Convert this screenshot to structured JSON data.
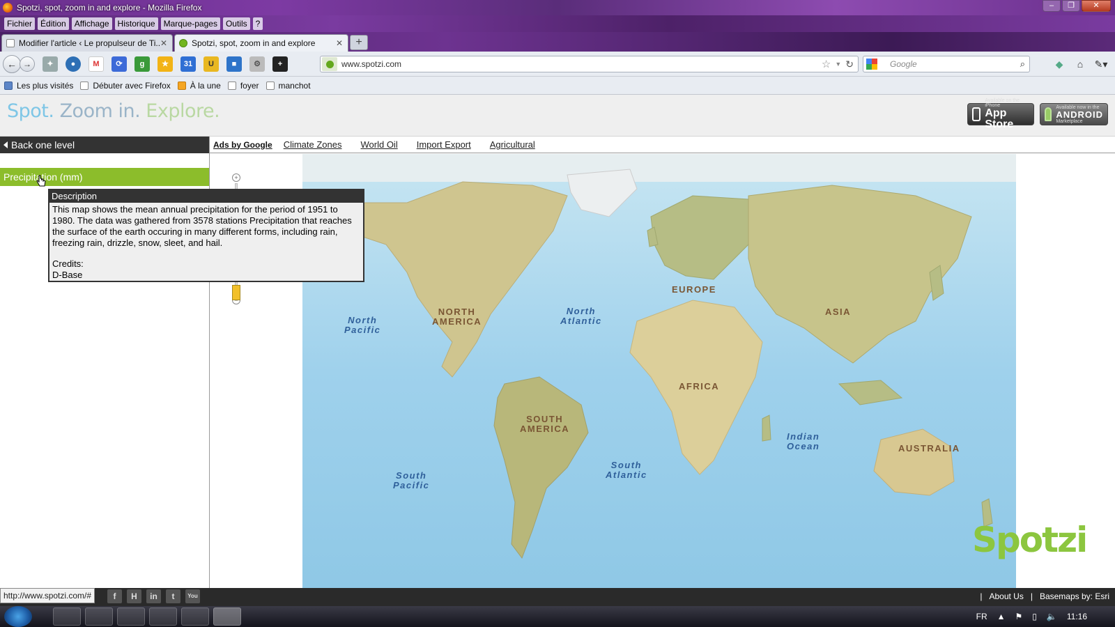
{
  "window": {
    "title": "Spotzi, spot, zoom in and explore - Mozilla Firefox"
  },
  "menu": [
    "Fichier",
    "Édition",
    "Affichage",
    "Historique",
    "Marque-pages",
    "Outils",
    "?"
  ],
  "tabs": [
    {
      "label": "Modifier l'article ‹ Le propulseur de Ti..."
    },
    {
      "label": "Spotzi, spot, zoom in and explore"
    }
  ],
  "address": {
    "url": "www.spotzi.com"
  },
  "search": {
    "placeholder": "Google"
  },
  "bookmarks": [
    "Les plus visités",
    "Débuter avec Firefox",
    "À la une",
    "foyer",
    "manchot"
  ],
  "header": {
    "tagline": {
      "spot": "Spot.",
      "zoom": "Zoom in.",
      "explore": "Explore."
    },
    "appstore": {
      "small": "Available on the iPhone",
      "big": "App Store"
    },
    "android": {
      "small": "Available now in the",
      "big": "ANDROID",
      "market": "Marketplace"
    }
  },
  "sidebar": {
    "back_label": "Back one level",
    "layer_label": "Precipitation (mm)"
  },
  "ads": {
    "label": "Ads by Google",
    "links": [
      "Climate Zones",
      "World Oil",
      "Import Export",
      "Agricultural"
    ]
  },
  "tooltip": {
    "heading": "Description",
    "text": "This map shows the mean annual precipitation for the period of 1951 to 1980. The data was gathered from 3578 stations Precipitation that reaches the surface of the earth occuring in many different forms, including rain, freezing rain, drizzle, snow, sleet, and hail.",
    "credits_label": "Credits:",
    "credits_value": "D-Base"
  },
  "map": {
    "labels": {
      "north_america": "NORTH\nAMERICA",
      "south_america": "SOUTH\nAMERICA",
      "europe": "EUROPE",
      "asia": "ASIA",
      "africa": "AFRICA",
      "australia": "AUSTRALIA",
      "north_pacific": "North\nPacific",
      "south_pacific": "South\nPacific",
      "north_atlantic": "North\nAtlantic",
      "south_atlantic": "South\nAtlantic",
      "indian_ocean": "Indian\nOcean"
    }
  },
  "logo": "Spotzi",
  "status": {
    "url": "http://www.spotzi.com/#",
    "social": [
      "f",
      "H",
      "in",
      "t",
      "You"
    ],
    "footer_links": [
      "|",
      "About Us",
      "|",
      "Basemaps by: Esri"
    ]
  },
  "taskbar": {
    "lang": "FR",
    "time": "11:16"
  },
  "colors": {
    "accent_green": "#8cbd2b",
    "dark_bar": "#333333",
    "ocean": "#a9d8ef",
    "land": "#dcd3a6"
  }
}
